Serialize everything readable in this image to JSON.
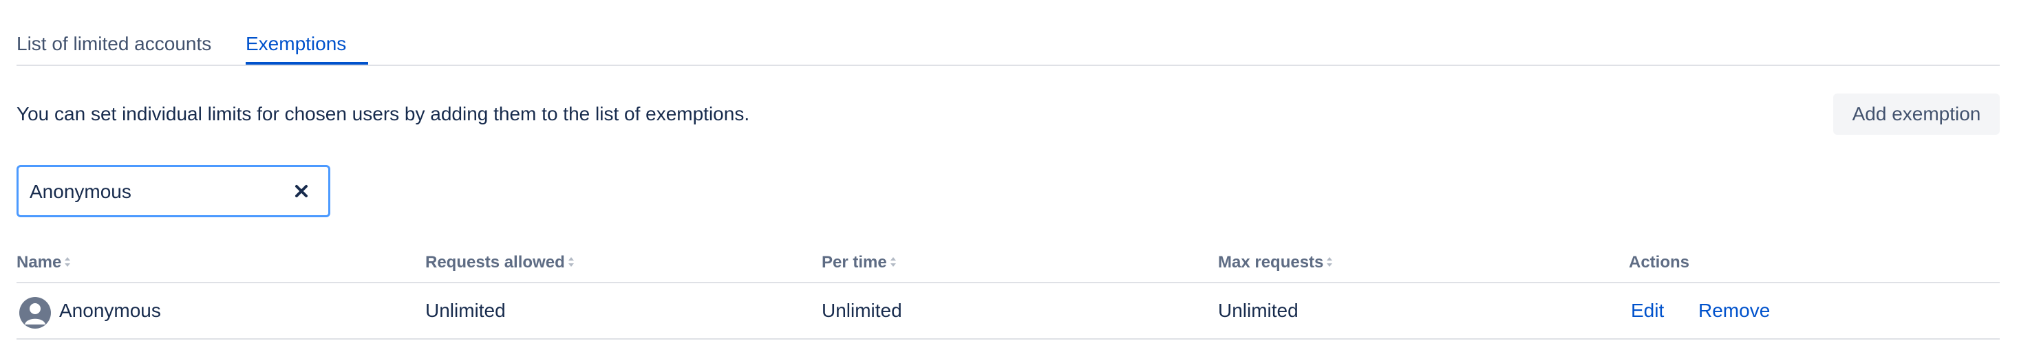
{
  "tabs": [
    {
      "label": "List of limited accounts",
      "active": false
    },
    {
      "label": "Exemptions",
      "active": true
    }
  ],
  "description": "You can set individual limits for chosen users by adding them to the list of exemptions.",
  "add_button_label": "Add exemption",
  "search": {
    "value": "Anonymous",
    "clear_icon": "close-icon"
  },
  "table": {
    "headers": {
      "name": "Name",
      "requests_allowed": "Requests allowed",
      "per_time": "Per time",
      "max_requests": "Max requests",
      "actions": "Actions"
    },
    "rows": [
      {
        "name": "Anonymous",
        "avatar_icon": "user-avatar-icon",
        "requests_allowed": "Unlimited",
        "per_time": "Unlimited",
        "max_requests": "Unlimited",
        "actions": {
          "edit": "Edit",
          "remove": "Remove"
        }
      }
    ]
  },
  "colors": {
    "accent": "#0052cc",
    "focus_border": "#4c9aff",
    "text": "#172b4d",
    "muted": "#5e6c84",
    "divider": "#dfe1e6"
  }
}
